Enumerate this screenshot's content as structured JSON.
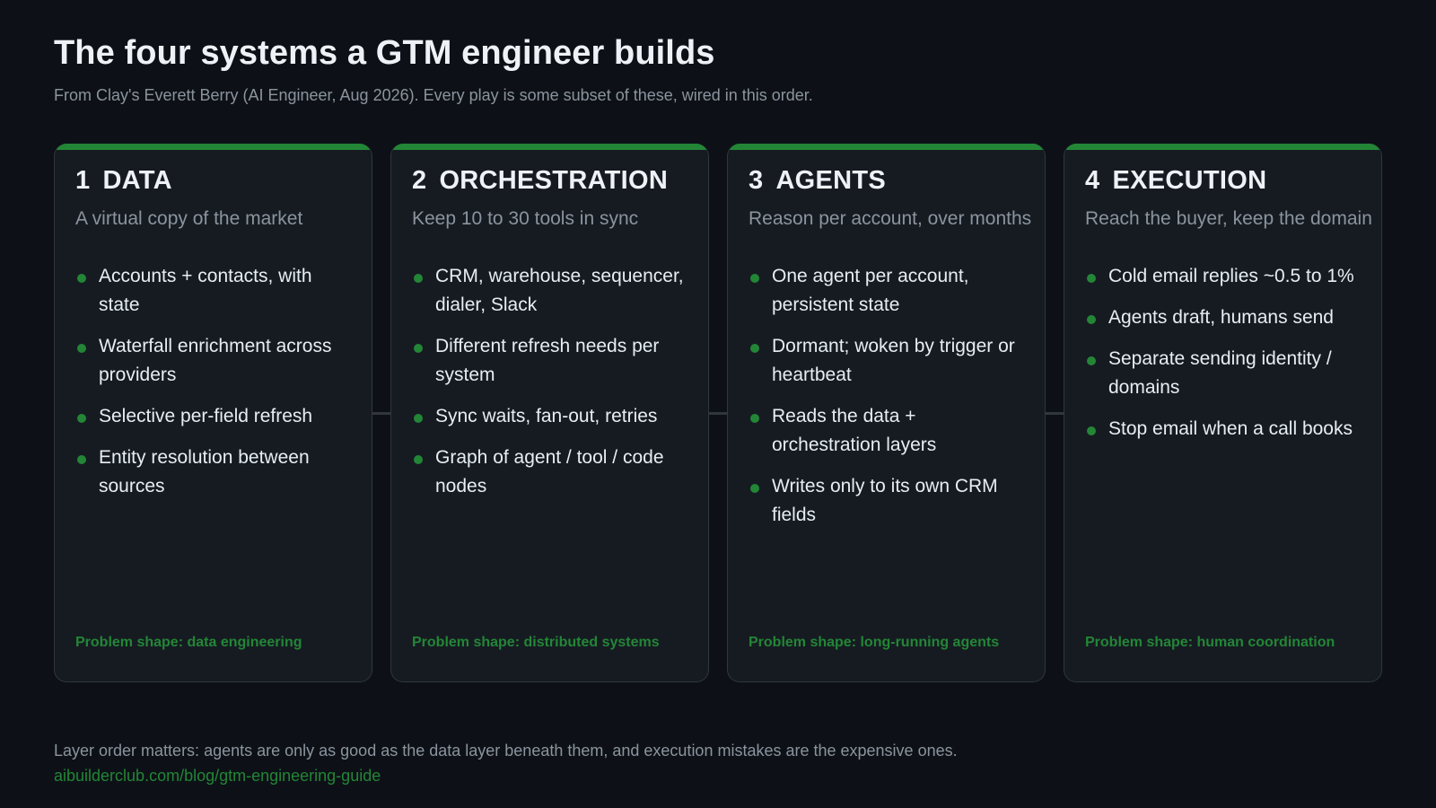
{
  "title": "The four systems a GTM engineer builds",
  "subtitle": "From Clay's Everett Berry (AI Engineer, Aug 2026). Every play is some subset of these, wired in this order.",
  "accent_color": "#238636",
  "cards": [
    {
      "number": "1",
      "name": "DATA",
      "tagline": "A virtual copy of the market",
      "bullets": [
        "Accounts + contacts, with state",
        "Waterfall enrichment across providers",
        "Selective per-field refresh",
        "Entity resolution between sources"
      ],
      "footer": "Problem shape: data engineering"
    },
    {
      "number": "2",
      "name": "ORCHESTRATION",
      "tagline": "Keep 10 to 30 tools in sync",
      "bullets": [
        "CRM, warehouse, sequencer, dialer, Slack",
        "Different refresh needs per system",
        "Sync waits, fan-out, retries",
        "Graph of agent / tool / code nodes"
      ],
      "footer": "Problem shape: distributed systems"
    },
    {
      "number": "3",
      "name": "AGENTS",
      "tagline": "Reason per account, over months",
      "bullets": [
        "One agent per account, persistent state",
        "Dormant; woken by trigger or heartbeat",
        "Reads the data + orchestration layers",
        "Writes only to its own CRM fields"
      ],
      "footer": "Problem shape: long-running agents"
    },
    {
      "number": "4",
      "name": "EXECUTION",
      "tagline": "Reach the buyer, keep the domain",
      "bullets": [
        "Cold email replies ~0.5 to 1%",
        "Agents draft, humans send",
        "Separate sending identity / domains",
        "Stop email when a call books"
      ],
      "footer": "Problem shape: human coordination"
    }
  ],
  "footnote": "Layer order matters: agents are only as good as the data layer beneath them, and execution mistakes are the expensive ones.",
  "link": "aibuilderclub.com/blog/gtm-engineering-guide"
}
